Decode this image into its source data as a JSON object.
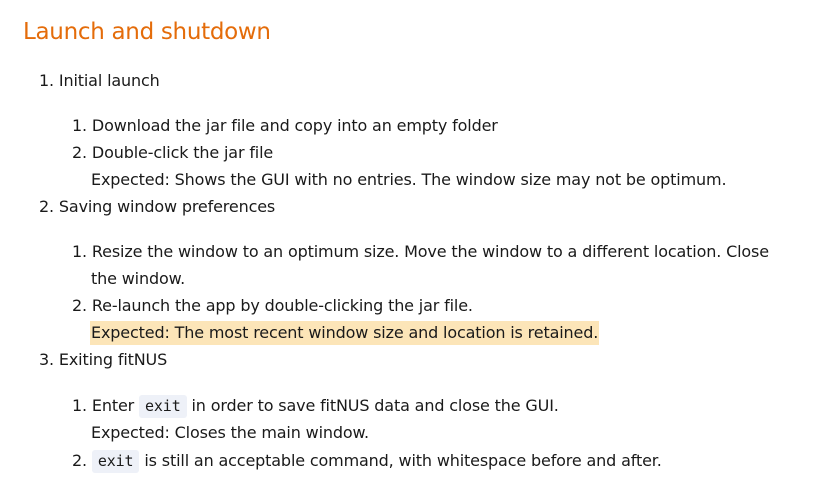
{
  "section": {
    "title": "Launch and shutdown"
  },
  "items": [
    {
      "num": "1.",
      "label": "Initial launch",
      "steps": [
        {
          "num": "1.",
          "text": "Download the jar file and copy into an empty folder"
        },
        {
          "num": "2.",
          "text": "Double-click the jar file",
          "expected": "Expected: Shows the GUI with no entries. The window size may not be optimum."
        }
      ]
    },
    {
      "num": "2.",
      "label": "Saving window preferences",
      "steps": [
        {
          "num": "1.",
          "text_line1": "Resize the window to an optimum size. Move the window to a different location. Close",
          "text_line2": "the window."
        },
        {
          "num": "2.",
          "text": "Re-launch the app by double-clicking the jar file.",
          "expected": "Expected: The most recent window size and location is retained."
        }
      ]
    },
    {
      "num": "3.",
      "label": "Exiting fitNUS",
      "steps": [
        {
          "num": "1.",
          "pre": "Enter",
          "code": "exit",
          "post": "in order to save fitNUS data and close the GUI.",
          "expected": "Expected: Closes the main window."
        },
        {
          "num": "2.",
          "code": "exit",
          "post": "is still an acceptable command, with whitespace before and after."
        }
      ]
    }
  ],
  "colors": {
    "heading": "#e46c0a",
    "highlight": "#fce5b8",
    "code_bg": "#eef1f8"
  }
}
